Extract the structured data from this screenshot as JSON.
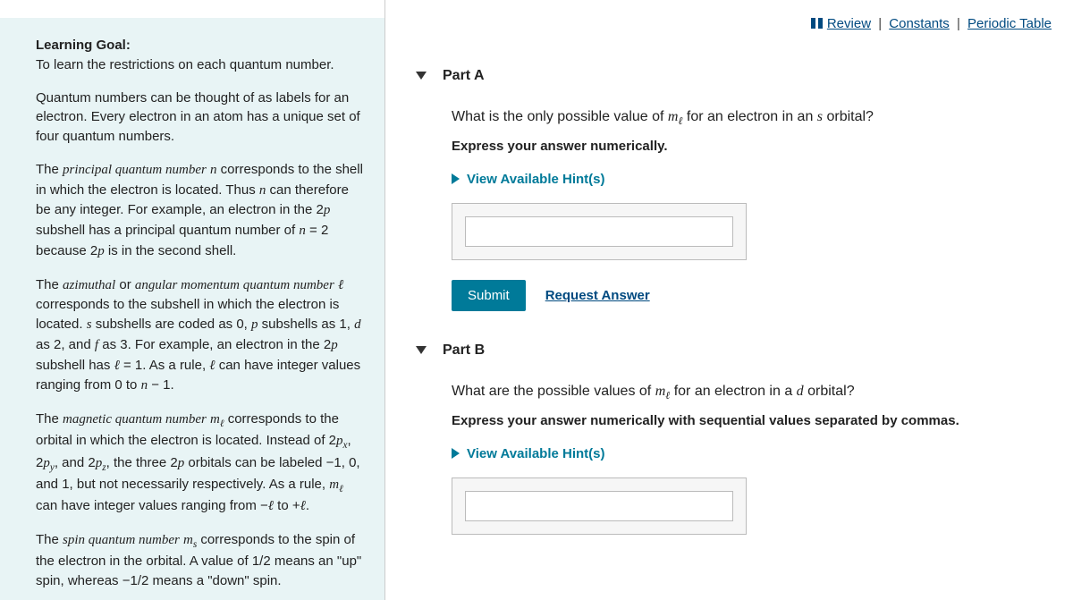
{
  "topLinks": {
    "review": "Review",
    "constants": "Constants",
    "periodicTable": "Periodic Table"
  },
  "leftPanel": {
    "learningGoalLabel": "Learning Goal:",
    "learningGoalText": "To learn the restrictions on each quantum number.",
    "intro": "Quantum numbers can be thought of as labels for an electron. Every electron in an atom has a unique set of four quantum numbers.",
    "principal_pre": "The ",
    "principal_em": "principal quantum number",
    "principal_post": " corresponds to the shell in which the electron is located. Thus ",
    "principal_rest": " can therefore be any integer. For example, an electron in the 2",
    "principal_rest2": " subshell has a principal quantum number of ",
    "principal_rest3": " because 2",
    "principal_rest4": " is in the second shell.",
    "az_pre": "The ",
    "az_em": "azimuthal",
    "az_or": " or ",
    "az_em2": "angular momentum quantum number",
    "az_post": " corresponds to the subshell in which the electron is located. ",
    "az_s": " subshells are coded as 0, ",
    "az_p": " subshells as 1, ",
    "az_d": " as 2, and ",
    "az_f": " as 3. For example, an electron in the 2",
    "az_sub": " subshell has ",
    "az_rule": ". As a rule, ",
    "az_range": " can have integer values ranging from 0 to ",
    "mag_pre": "The ",
    "mag_em": "magnetic quantum number",
    "mag_post": " corresponds to the orbital in which the electron is located. Instead of 2",
    "mag_and": " and 2",
    "mag_three": ", the three 2",
    "mag_orbitals": " orbitals can be labeled ",
    "mag_vals": "1, 0, and 1, but not necessarily respectively. As a rule, ",
    "mag_range": " can have integer values ranging from ",
    "mag_to": " to ",
    "spin_pre": "The ",
    "spin_em": "spin quantum number",
    "spin_post": " corresponds to the spin of the electron in the orbital. A value of ",
    "spin_means": " means an \"up\" spin, whereas ",
    "spin_down": " means a \"down\" spin."
  },
  "parts": {
    "a": {
      "title": "Part A",
      "question_pre": "What is the only possible value of ",
      "question_post": " for an electron in an ",
      "question_end": " orbital?",
      "instruction": "Express your answer numerically.",
      "hintsLabel": "View Available Hint(s)",
      "submitLabel": "Submit",
      "requestLabel": "Request Answer"
    },
    "b": {
      "title": "Part B",
      "question_pre": "What are the possible values of ",
      "question_post": " for an electron in a ",
      "question_end": " orbital?",
      "instruction": "Express your answer numerically with sequential values separated by commas.",
      "hintsLabel": "View Available Hint(s)"
    }
  }
}
